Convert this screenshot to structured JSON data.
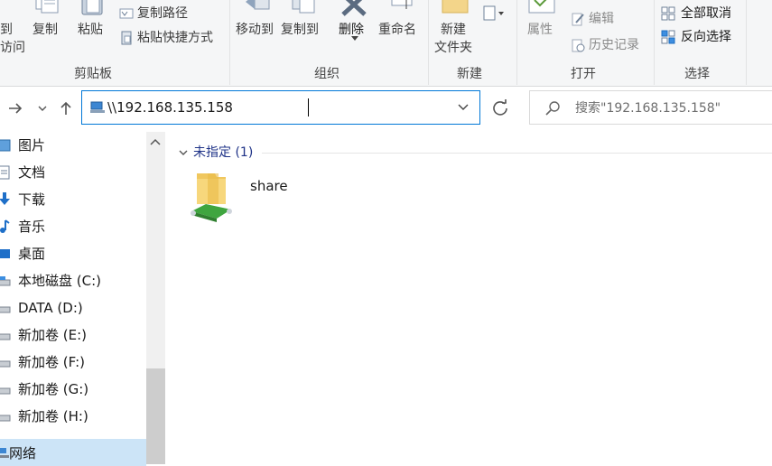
{
  "ribbon": {
    "clipboard": {
      "pin_partial_1": "到",
      "pin_partial_2": "访问",
      "copy": "复制",
      "paste": "粘贴",
      "copy_path": "复制路径",
      "paste_shortcut": "粘贴快捷方式",
      "group_label": "剪贴板"
    },
    "organize": {
      "move_to": "移动到",
      "copy_to": "复制到",
      "delete": "删除",
      "rename": "重命名",
      "group_label": "组织"
    },
    "new": {
      "new_folder_line1": "新建",
      "new_folder_line2": "文件夹",
      "group_label": "新建"
    },
    "open": {
      "properties": "属性",
      "edit": "编辑",
      "history": "历史记录",
      "group_label": "打开"
    },
    "select": {
      "select_none": "全部取消",
      "invert_selection": "反向选择",
      "group_label": "选择"
    }
  },
  "address": {
    "path": "\\\\192.168.135.158"
  },
  "search": {
    "placeholder": "搜索\"192.168.135.158\""
  },
  "nav_pane": {
    "items": [
      {
        "label": "图片",
        "icon": "pictures-icon"
      },
      {
        "label": "文档",
        "icon": "documents-icon"
      },
      {
        "label": "下载",
        "icon": "downloads-icon"
      },
      {
        "label": "音乐",
        "icon": "music-icon"
      },
      {
        "label": "桌面",
        "icon": "desktop-icon"
      },
      {
        "label": "本地磁盘 (C:)",
        "icon": "drive-icon"
      },
      {
        "label": "DATA (D:)",
        "icon": "drive-icon"
      },
      {
        "label": "新加卷 (E:)",
        "icon": "drive-icon"
      },
      {
        "label": "新加卷 (F:)",
        "icon": "drive-icon"
      },
      {
        "label": "新加卷 (G:)",
        "icon": "drive-icon"
      },
      {
        "label": "新加卷 (H:)",
        "icon": "drive-icon"
      },
      {
        "label": "网络",
        "icon": "network-icon"
      }
    ]
  },
  "content": {
    "group_label": "未指定 (1)",
    "items": [
      {
        "name": "share",
        "icon": "shared-folder-icon"
      }
    ]
  },
  "colors": {
    "accent": "#0078d7",
    "selected_bg": "#cce4f7",
    "group_header": "#1e3287"
  }
}
